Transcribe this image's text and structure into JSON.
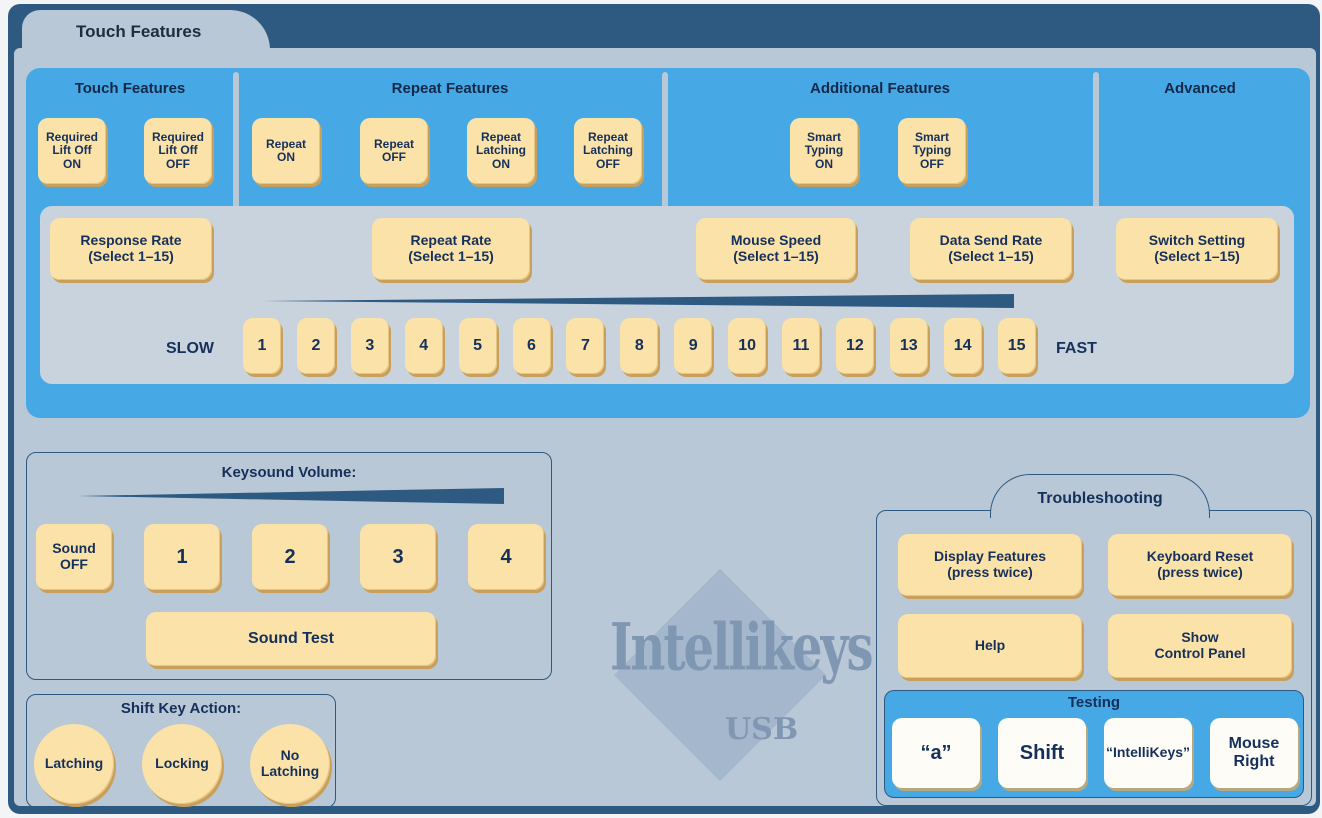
{
  "tab": {
    "title": "Touch Features"
  },
  "sections": {
    "touch": "Touch Features",
    "repeat": "Repeat Features",
    "additional": "Additional Features",
    "advanced": "Advanced"
  },
  "features": {
    "req_on": "Required\nLift Off\nON",
    "req_off": "Required\nLift Off\nOFF",
    "repeat_on": "Repeat\nON",
    "repeat_off": "Repeat\nOFF",
    "latch_on": "Repeat\nLatching\nON",
    "latch_off": "Repeat\nLatching\nOFF",
    "smart_on": "Smart\nTyping\nON",
    "smart_off": "Smart\nTyping\nOFF"
  },
  "rates": {
    "response": "Response Rate\n(Select 1–15)",
    "repeat": "Repeat Rate\n(Select 1–15)",
    "mouse": "Mouse Speed\n(Select 1–15)",
    "data": "Data Send Rate\n(Select 1–15)",
    "switch": "Switch Setting\n(Select 1–15)"
  },
  "speed": {
    "slow": "SLOW",
    "fast": "FAST",
    "levels": [
      "1",
      "2",
      "3",
      "4",
      "5",
      "6",
      "7",
      "8",
      "9",
      "10",
      "11",
      "12",
      "13",
      "14",
      "15"
    ]
  },
  "keysound": {
    "title": "Keysound Volume:",
    "off": "Sound\nOFF",
    "levels": [
      "1",
      "2",
      "3",
      "4"
    ],
    "test": "Sound Test"
  },
  "shift": {
    "title": "Shift Key Action:",
    "latching": "Latching",
    "locking": "Locking",
    "no_latching": "No\nLatching"
  },
  "troubleshooting": {
    "title": "Troubleshooting",
    "display": "Display Features\n(press twice)",
    "reset": "Keyboard Reset\n(press twice)",
    "help": "Help",
    "control": "Show\nControl Panel"
  },
  "testing": {
    "title": "Testing",
    "a": "“a”",
    "shift": "Shift",
    "intellikeys": "“IntelliKeys”",
    "mouse_right": "Mouse\nRight"
  },
  "logo": {
    "brand": "Intellikeys",
    "usb": "USB"
  },
  "colors": {
    "frame": "#2e5a82",
    "panel": "#b9c8d7",
    "blue": "#46a8e5",
    "key": "#fbe2a8"
  }
}
